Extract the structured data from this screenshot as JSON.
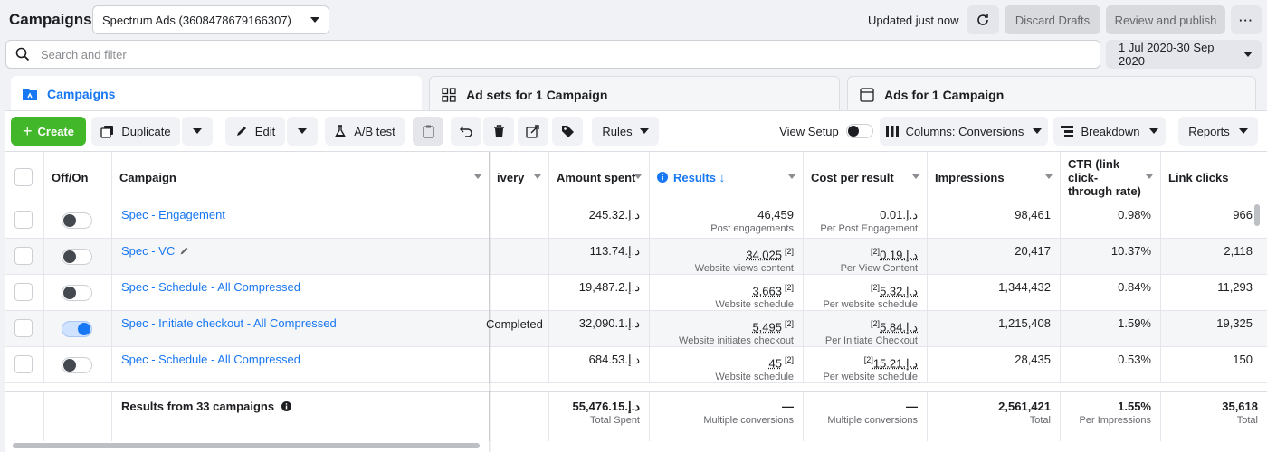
{
  "header": {
    "title": "Campaigns",
    "account": "Spectrum Ads (3608478679166307)",
    "updated": "Updated just now",
    "discard": "Discard Drafts",
    "publish": "Review and publish",
    "more": "···"
  },
  "search": {
    "placeholder": "Search and filter"
  },
  "date_range": "1 Jul 2020-30 Sep 2020",
  "tabs": [
    {
      "label": "Campaigns"
    },
    {
      "label": "Ad sets for 1 Campaign"
    },
    {
      "label": "Ads for 1 Campaign"
    }
  ],
  "toolbar": {
    "create": "Create",
    "duplicate": "Duplicate",
    "edit": "Edit",
    "ab_test": "A/B test",
    "rules": "Rules",
    "view_setup": "View Setup",
    "columns": "Columns: Conversions",
    "breakdown": "Breakdown",
    "reports": "Reports"
  },
  "columns": {
    "offon": "Off/On",
    "campaign": "Campaign",
    "delivery": "ivery",
    "amount": "Amount spent",
    "results": "Results ↓",
    "cpr": "Cost per result",
    "impressions": "Impressions",
    "ctr": "CTR (link click-through rate)",
    "link_clicks": "Link clicks"
  },
  "rows": [
    {
      "name": "Spec - Engagement",
      "delivery": "",
      "amount": "د.إ.245.32",
      "results": "46,459",
      "results_sub": "Post engagements",
      "cpr": "د.إ.0.01",
      "cpr_sub": "Per Post Engagement",
      "impressions": "98,461",
      "ctr": "0.98%",
      "clicks": "966",
      "on": false
    },
    {
      "name": "Spec - VC",
      "delivery": "",
      "amount": "د.إ.113.74",
      "results": "34,025",
      "results_sub": "Website views content",
      "cpr": "د.إ.0.19",
      "cpr_sub": "Per View Content",
      "impressions": "20,417",
      "ctr": "10.37%",
      "clicks": "2,118",
      "on": false
    },
    {
      "name": "Spec - Schedule - All Compressed",
      "delivery": "",
      "amount": "د.إ.19,487.2",
      "results": "3,663",
      "results_sub": "Website schedule",
      "cpr": "د.إ.5.32",
      "cpr_sub": "Per website schedule",
      "impressions": "1,344,432",
      "ctr": "0.84%",
      "clicks": "11,293",
      "on": false
    },
    {
      "name": "Spec - Initiate checkout - All Compressed",
      "delivery": "Completed",
      "amount": "د.إ.32,090.1",
      "results": "5,495",
      "results_sub": "Website initiates checkout",
      "cpr": "د.إ.5.84",
      "cpr_sub": "Per Initiate Checkout",
      "impressions": "1,215,408",
      "ctr": "1.59%",
      "clicks": "19,325",
      "on": true
    },
    {
      "name": "Spec - Schedule - All Compressed",
      "delivery": "",
      "amount": "د.إ.684.53",
      "results": "45",
      "results_sub": "Website schedule",
      "cpr": "د.إ.15.21",
      "cpr_sub": "Per website schedule",
      "impressions": "28,435",
      "ctr": "0.53%",
      "clicks": "150",
      "on": false
    }
  ],
  "sup": "[2]",
  "totals": {
    "label": "Results from 33 campaigns",
    "amount": "د.إ.55,476.15",
    "amount_sub": "Total Spent",
    "results": "—",
    "results_sub": "Multiple conversions",
    "cpr": "—",
    "cpr_sub": "Multiple conversions",
    "impressions": "2,561,421",
    "impressions_sub": "Total",
    "ctr": "1.55%",
    "ctr_sub": "Per Impressions",
    "clicks": "35,618",
    "clicks_sub": "Total"
  },
  "colors": {
    "accent": "#1877f2",
    "create": "#42b72a"
  }
}
